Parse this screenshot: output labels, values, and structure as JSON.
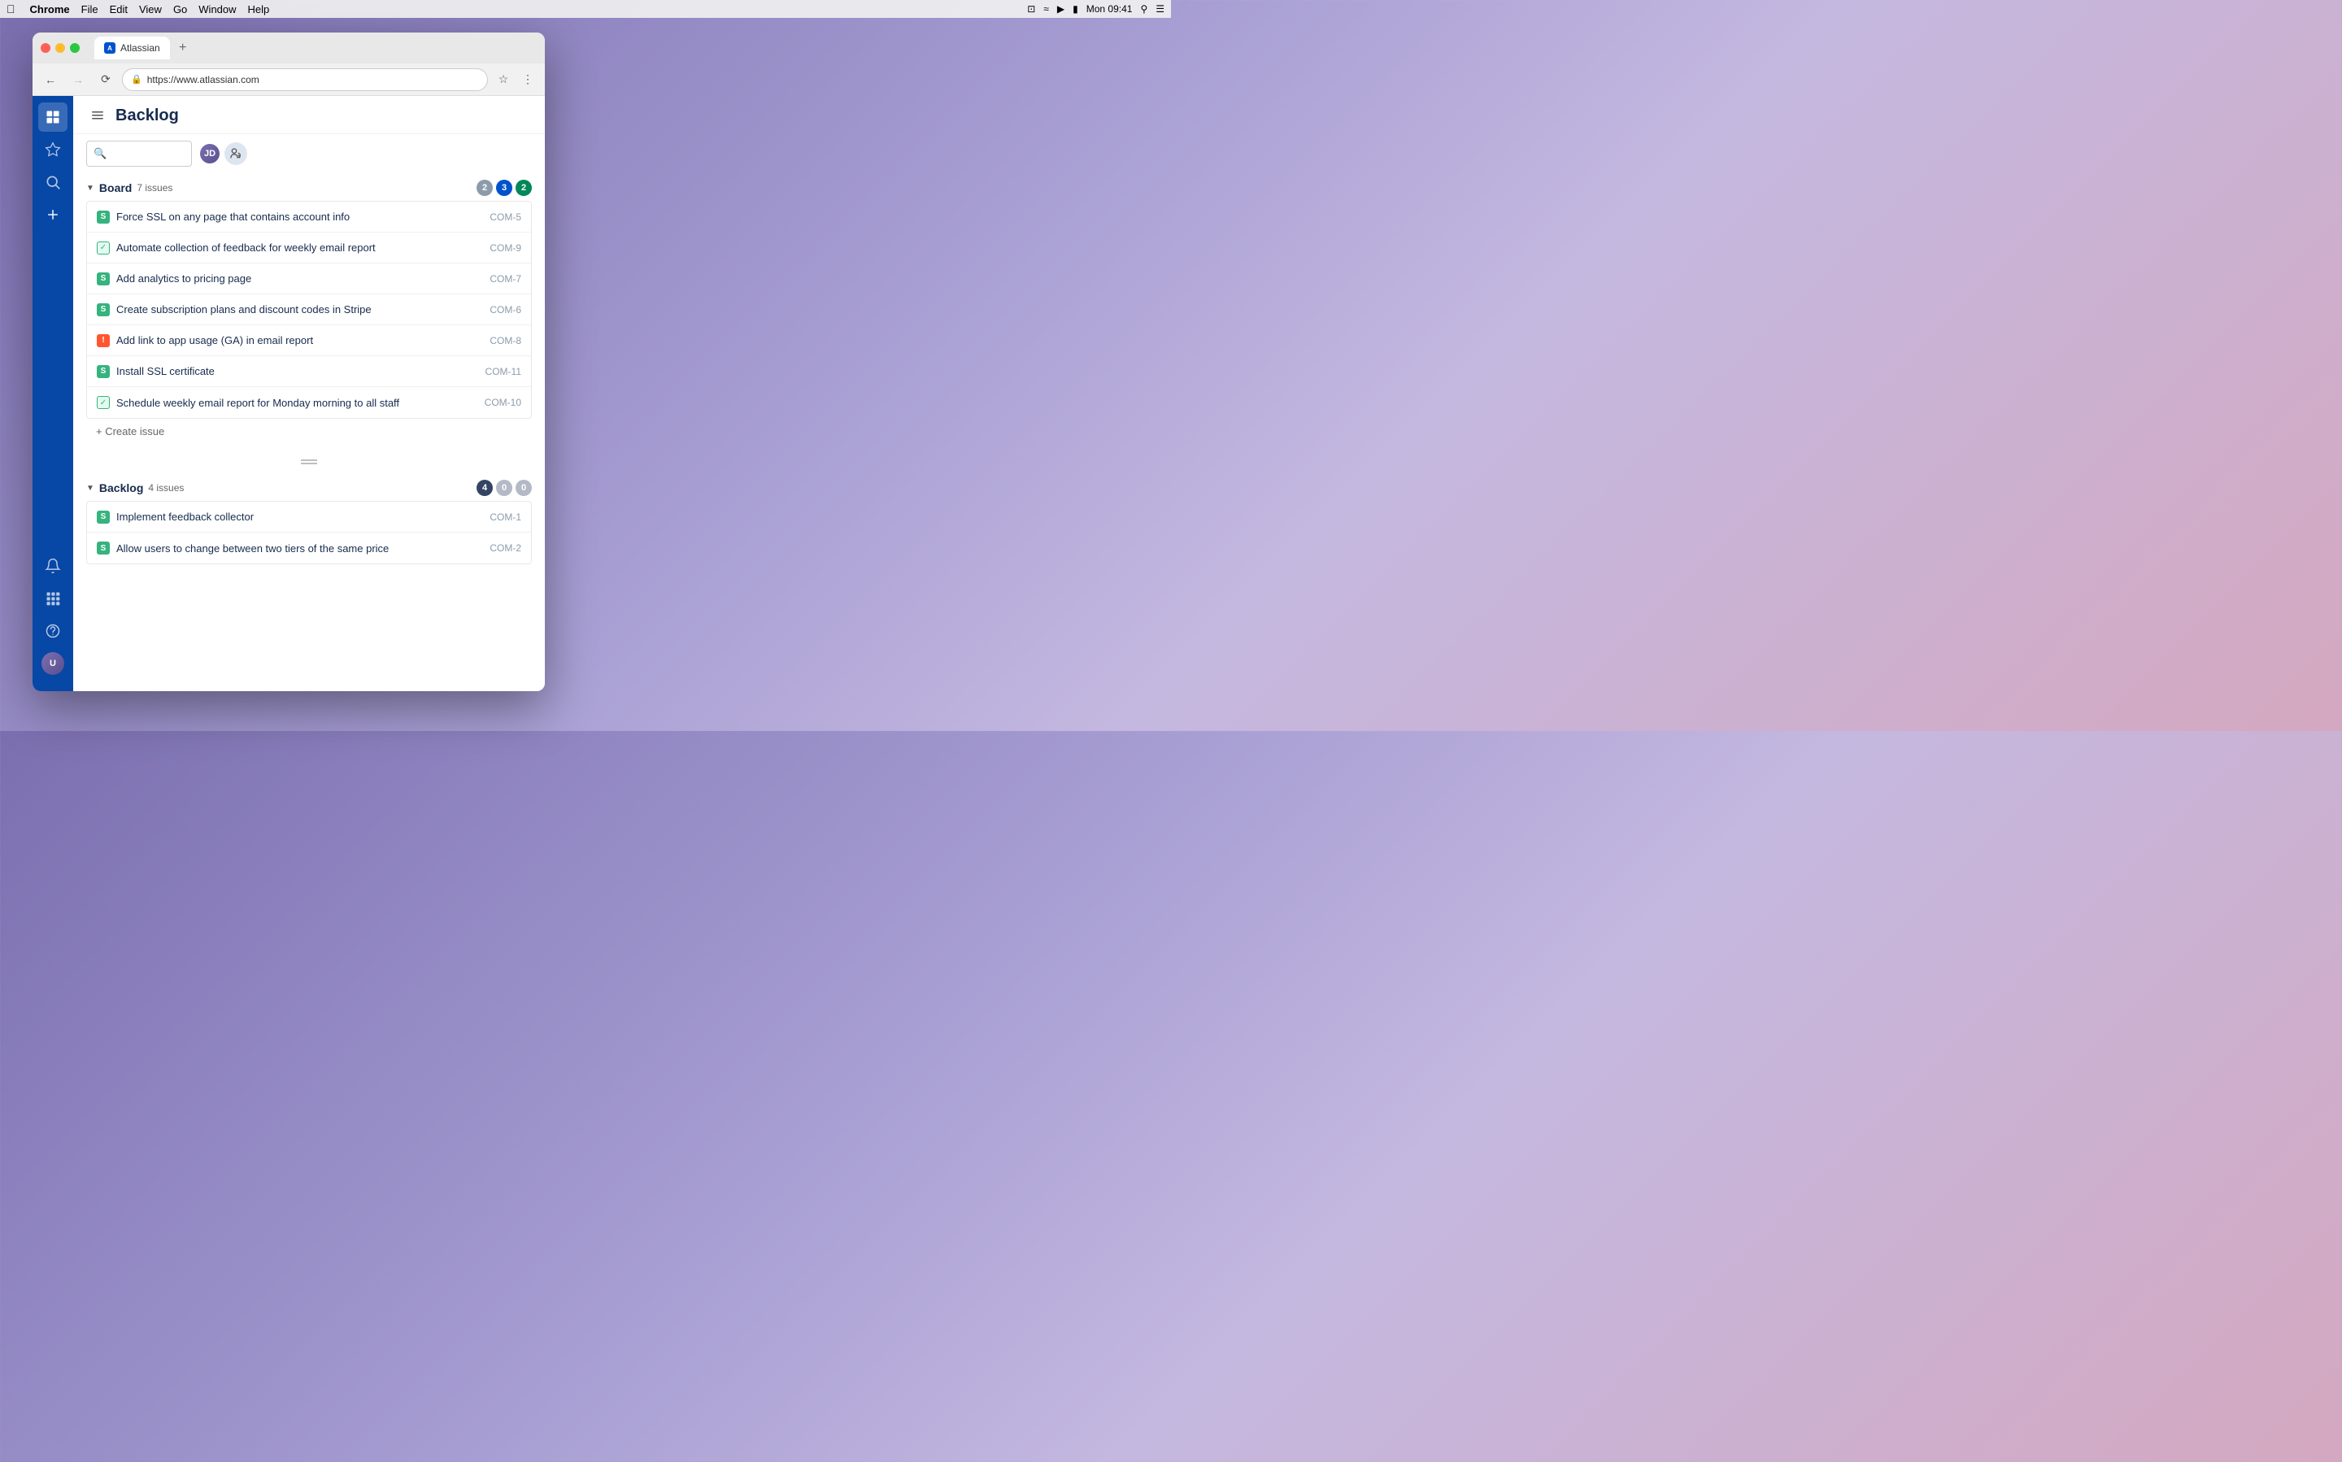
{
  "menubar": {
    "apple": "&#63743;",
    "app_name": "Chrome",
    "menus": [
      "File",
      "Edit",
      "View",
      "Go",
      "Window",
      "Help"
    ],
    "time": "Mon 09:41"
  },
  "browser": {
    "tab_title": "Atlassian",
    "url": "https://www.atlassian.com",
    "new_tab_label": "+"
  },
  "page": {
    "title": "Backlog",
    "search_placeholder": ""
  },
  "sidebar": {
    "items": [
      {
        "id": "home",
        "label": "Home",
        "active": true
      },
      {
        "id": "starred",
        "label": "Starred"
      },
      {
        "id": "search",
        "label": "Search"
      },
      {
        "id": "create",
        "label": "Create"
      }
    ],
    "bottom": [
      {
        "id": "notifications",
        "label": "Notifications"
      },
      {
        "id": "apps",
        "label": "Apps"
      },
      {
        "id": "help",
        "label": "Help"
      },
      {
        "id": "profile",
        "label": "Profile"
      }
    ]
  },
  "board_section": {
    "title": "Board",
    "issue_count": "7 issues",
    "badges": [
      {
        "value": "2",
        "color": "gray"
      },
      {
        "value": "3",
        "color": "blue"
      },
      {
        "value": "2",
        "color": "green"
      }
    ],
    "issues": [
      {
        "id": "COM-5",
        "title": "Force SSL on any page that contains account info",
        "type": "story",
        "icon_type": "story"
      },
      {
        "id": "COM-9",
        "title": "Automate collection of feedback for weekly email report",
        "type": "check",
        "icon_type": "check"
      },
      {
        "id": "COM-7",
        "title": "Add analytics to pricing page",
        "type": "story",
        "icon_type": "story"
      },
      {
        "id": "COM-6",
        "title": "Create subscription plans and discount codes in Stripe",
        "type": "story",
        "icon_type": "story"
      },
      {
        "id": "COM-8",
        "title": "Add link to app usage (GA) in email report",
        "type": "bug",
        "icon_type": "bug"
      },
      {
        "id": "COM-11",
        "title": "Install SSL certificate",
        "type": "story",
        "icon_type": "story"
      },
      {
        "id": "COM-10",
        "title": "Schedule weekly email report for Monday morning to all staff",
        "type": "check",
        "icon_type": "check"
      }
    ],
    "create_label": "+ Create issue"
  },
  "backlog_section": {
    "title": "Backlog",
    "issue_count": "4 issues",
    "badges": [
      {
        "value": "4",
        "color": "dark"
      },
      {
        "value": "0",
        "color": "zero"
      },
      {
        "value": "0",
        "color": "zero"
      }
    ],
    "issues": [
      {
        "id": "COM-1",
        "title": "Implement feedback collector",
        "type": "story",
        "icon_type": "story"
      },
      {
        "id": "COM-2",
        "title": "Allow users to change between two tiers of the same price",
        "type": "story",
        "icon_type": "story"
      }
    ]
  }
}
